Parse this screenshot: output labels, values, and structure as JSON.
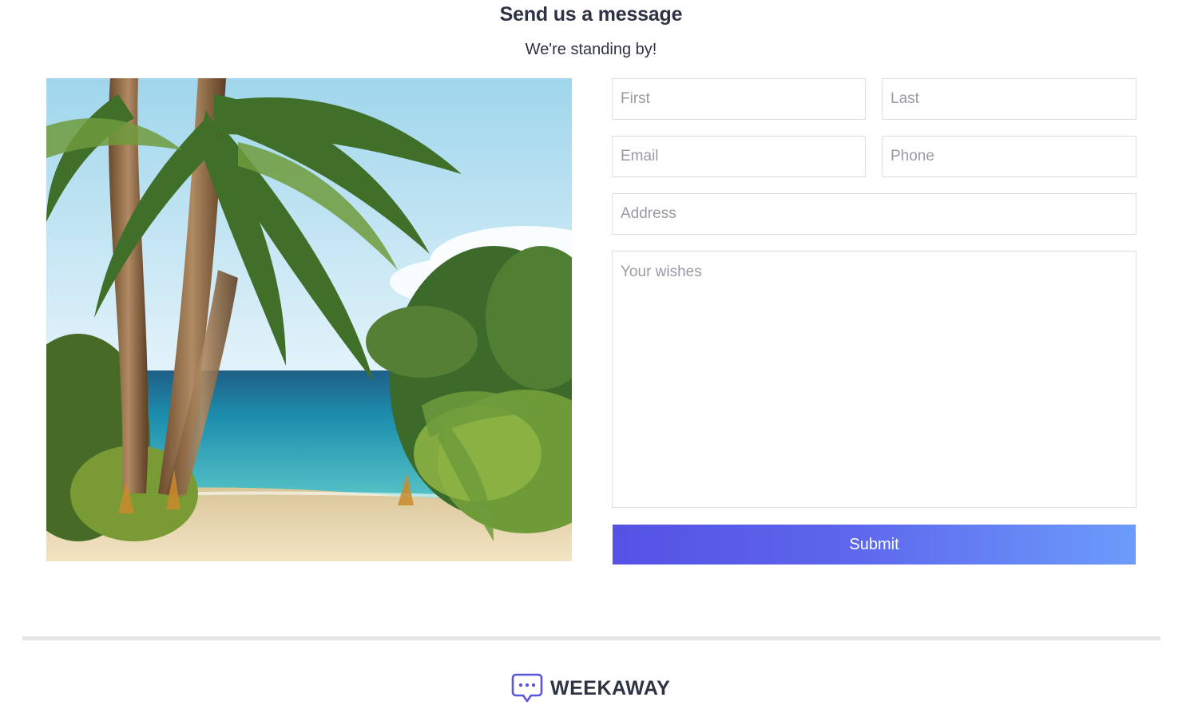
{
  "contact": {
    "title": "Send us a message",
    "subtitle": "We're standing by!"
  },
  "form": {
    "first_placeholder": "First",
    "last_placeholder": "Last",
    "email_placeholder": "Email",
    "phone_placeholder": "Phone",
    "address_placeholder": "Address",
    "wishes_placeholder": "Your wishes",
    "submit_label": "Submit"
  },
  "footer": {
    "brand_name": "WEEKAWAY",
    "brand_icon": "chat-bubble-icon"
  },
  "colors": {
    "accent_start": "#5552e4",
    "accent_end": "#6b9cfb",
    "brand_icon": "#5a55e0",
    "text_dark": "#2e3344"
  }
}
